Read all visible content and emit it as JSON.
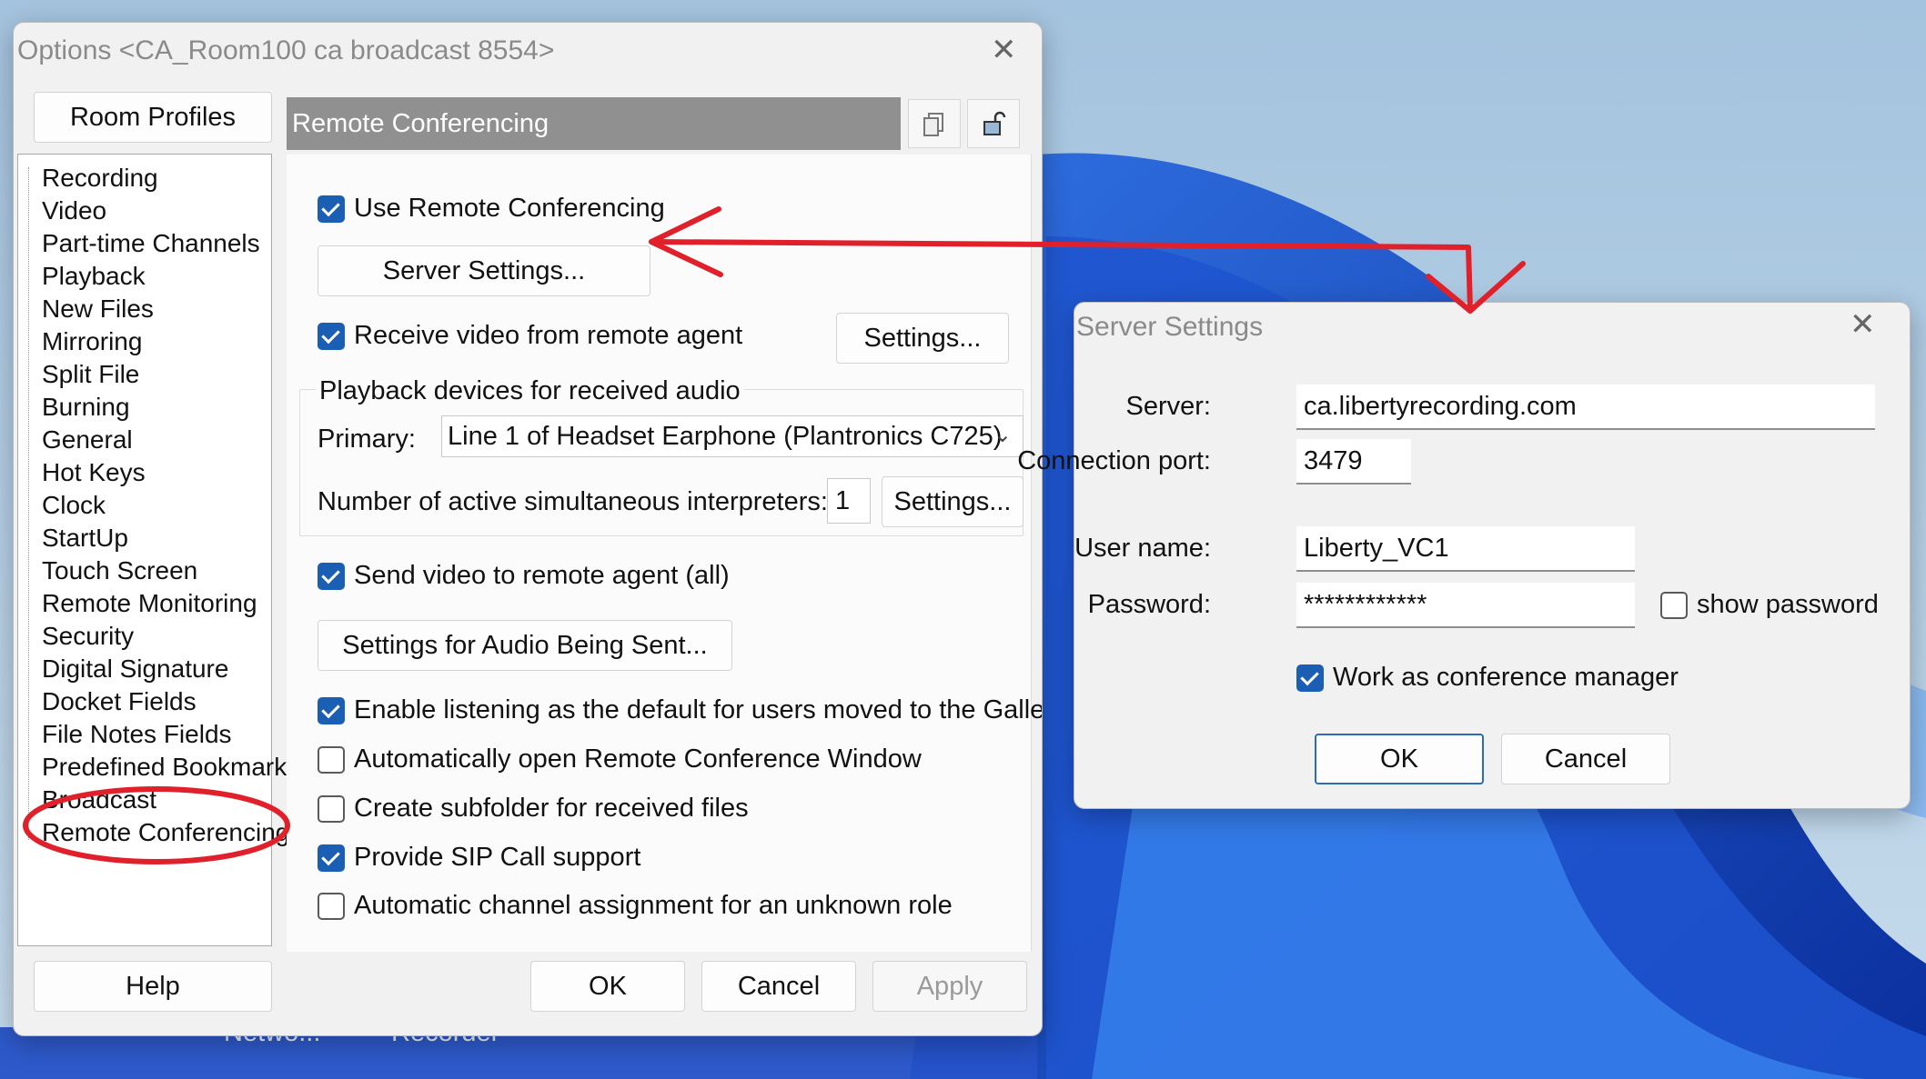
{
  "options_dialog": {
    "title": "Options <CA_Room100 ca broadcast 8554>",
    "room_profiles_button": "Room Profiles",
    "section_header": "Remote Conferencing",
    "nav_items": [
      "Recording",
      "Video",
      "Part-time Channels",
      "Playback",
      "New Files",
      "Mirroring",
      "Split File",
      "Burning",
      "General",
      "Hot Keys",
      "Clock",
      "StartUp",
      "Touch Screen",
      "Remote Monitoring",
      "Security",
      "Digital Signature",
      "Docket Fields",
      "File Notes Fields",
      "Predefined Bookmark",
      "Broadcast",
      "Remote Conferencing"
    ],
    "use_remote_conferencing": {
      "label": "Use Remote Conferencing",
      "checked": true
    },
    "server_settings_button": "Server Settings...",
    "receive_video": {
      "label": "Receive video from remote agent",
      "checked": true
    },
    "receive_video_settings_button": "Settings...",
    "playback_group_label": "Playback devices for received audio",
    "primary_label": "Primary:",
    "primary_value": "Line 1 of Headset Earphone (Plantronics C725)",
    "interpreters_label": "Number of active simultaneous interpreters:",
    "interpreters_value": "1",
    "interpreters_settings_button": "Settings...",
    "send_video": {
      "label": "Send video to remote agent (all)",
      "checked": true
    },
    "audio_sent_button": "Settings for Audio Being Sent...",
    "options": [
      {
        "label": "Enable listening as the default for users moved to the Gallery",
        "checked": true
      },
      {
        "label": "Automatically open Remote Conference Window",
        "checked": false
      },
      {
        "label": "Create subfolder for received files",
        "checked": false
      },
      {
        "label": "Provide SIP Call support",
        "checked": true
      },
      {
        "label": "Automatic channel assignment for an unknown role",
        "checked": false
      }
    ],
    "help_button": "Help",
    "ok_button": "OK",
    "cancel_button": "Cancel",
    "apply_button": "Apply"
  },
  "server_dialog": {
    "title": "Server Settings",
    "server_label": "Server:",
    "server_value": "ca.libertyrecording.com",
    "port_label": "Connection port:",
    "port_value": "3479",
    "username_label": "User name:",
    "username_value": "Liberty_VC1",
    "password_label": "Password:",
    "password_value": "************",
    "show_password": {
      "label": "show password",
      "checked": false
    },
    "conference_manager": {
      "label": "Work as conference manager",
      "checked": true
    },
    "ok_button": "OK",
    "cancel_button": "Cancel"
  },
  "taskbar": {
    "labels": [
      "Netwo...",
      "Recorder"
    ]
  },
  "colors": {
    "annotation_red": "#e0202a",
    "checkbox_blue": "#1a5fb4",
    "header_gray": "#909090"
  }
}
